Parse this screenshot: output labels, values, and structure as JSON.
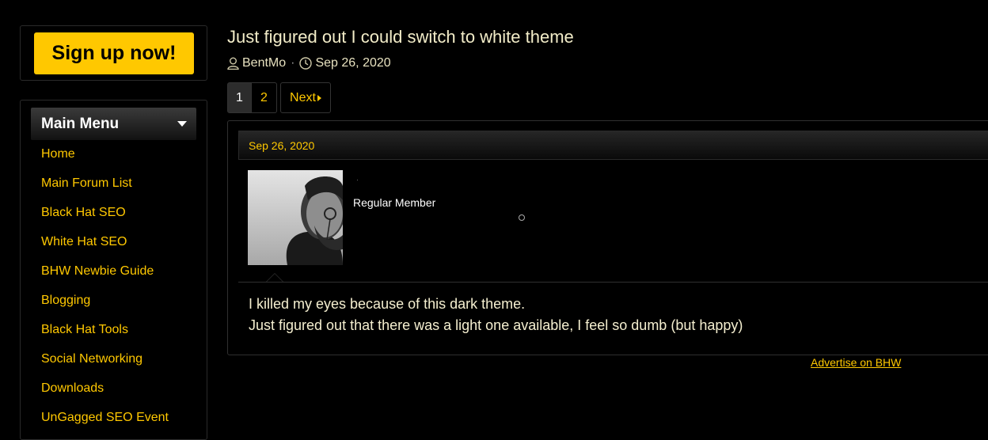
{
  "sidebar": {
    "signup_label": "Sign up now!",
    "menu_title": "Main Menu",
    "menu_items": [
      "Home",
      "Main Forum List",
      "Black Hat SEO",
      "White Hat SEO",
      "BHW Newbie Guide",
      "Blogging",
      "Black Hat Tools",
      "Social Networking",
      "Downloads",
      "UnGagged SEO Event"
    ]
  },
  "thread": {
    "title": "Just figured out I could switch to white theme",
    "author": "BentMo",
    "date": "Sep 26, 2020"
  },
  "pagination": {
    "current": "1",
    "pages": [
      "2"
    ],
    "next_label": "Next"
  },
  "post": {
    "date": "Sep 26, 2020",
    "user_title": "Regular Member",
    "body_lines": [
      "I killed my eyes because of this dark theme.",
      "Just figured out that there was a light one available, I feel so dumb (but happy)"
    ]
  },
  "advert_label": "Advertise on BHW",
  "colors": {
    "accent": "#ffc800",
    "background": "#000000",
    "text": "#f5efd0"
  },
  "icons": [
    "user-icon",
    "clock-icon",
    "caret-down-icon",
    "next-arrow-icon"
  ]
}
